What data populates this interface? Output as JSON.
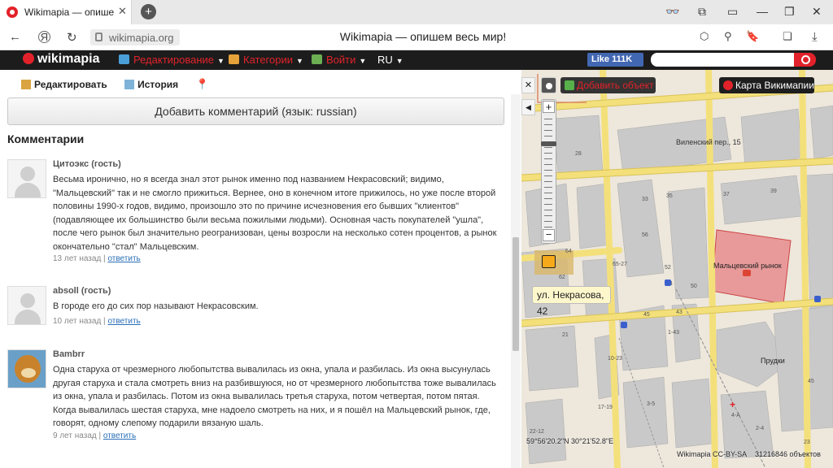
{
  "browser": {
    "tab_title": "Wikimapia — опишем в",
    "url": "wikimapia.org",
    "page_title": "Wikimapia — опишем весь мир!"
  },
  "header": {
    "logo": "wikimapia",
    "menu": [
      {
        "label": "Редактирование",
        "icon": "edit-globe-icon"
      },
      {
        "label": "Категории",
        "icon": "categories-icon"
      },
      {
        "label": "Войти",
        "icon": "login-icon"
      }
    ],
    "lang": "RU",
    "fb_like": "Like 111K",
    "search_placeholder": ""
  },
  "panel": {
    "toolbar": [
      {
        "label": "Редактировать",
        "icon": "edit-icon"
      },
      {
        "label": "История",
        "icon": "history-icon"
      },
      {
        "label": "",
        "icon": "map-pin-icon"
      }
    ],
    "add_comment": "Добавить комментарий (язык: russian)",
    "comments_heading": "Комментарии",
    "reply_label": "ответить",
    "comments": [
      {
        "author": "Цитоэкс (гость)",
        "text": "Весьма иронично, но я всегда знал этот рынок именно под названием Некрасовский; видимо, \"Мальцевский\" так и не смогло прижиться. Вернее, оно в конечном итоге прижилось, но уже после второй половины 1990-х годов, видимо, произошло это по причине исчезновения его бывших \"клиентов\" (подавляющее их большинство были весьма пожилыми людьми). Основная часть покупателей \"ушла\", после чего рынок был значительно реогранизован, цены возросли на несколько сотен процентов, а рынок окончательно \"стал\" Мальцевским.",
        "age": "13 лет назад",
        "avatar": "default"
      },
      {
        "author": "absoll (гость)",
        "text": "В городе его до сих пор называют Некрасовским.",
        "age": "10 лет назад",
        "avatar": "default"
      },
      {
        "author": "Bambrr",
        "text": "Одна старуха от чрезмерного любопытства вывалилась из окна, упала и разбилась. Из окна высунулась другая старуха и стала смотреть вниз на разбившуюся, но от чрезмерного любопытства тоже вывалилась из окна, упала и разбилась. Потом из окна вывалилась третья старуха, потом четвертая, потом пятая. Когда вывалилась шестая старуха, мне надоело смотреть на них, и я пошёл на Мальцевский рынок, где, говорят, одному слепому подарили вязаную шаль.",
        "age": "9 лет назад",
        "avatar": "bear"
      }
    ]
  },
  "map": {
    "add_object": "Добавить объект",
    "map_name": "Карта Викимапии",
    "tooltip": "ул. Некрасова, 42",
    "street_label": "Виленский пер., 15",
    "market_label": "Мальцевский рынок",
    "area_label": "Прудки",
    "coords": "59°56'20.2\"N 30°21'52.8\"E",
    "copyright": "Wikimapia CC-BY-SA",
    "object_count": "31216846 объектов",
    "building_numbers": [
      "28",
      "33",
      "35",
      "37",
      "39",
      "50",
      "56",
      "65-27",
      "64",
      "62",
      "52",
      "54",
      "45",
      "43",
      "1-43",
      "21",
      "17-19",
      "3-5",
      "10-23",
      "22-12",
      "2-4",
      "4-A",
      "45",
      "23"
    ]
  },
  "colors": {
    "brand_red": "#e2222a",
    "header_bg": "#1c1c1c",
    "link_blue": "#2a6fb8",
    "road_yellow": "#f4e07a",
    "market_fill": "#e89a9a"
  }
}
